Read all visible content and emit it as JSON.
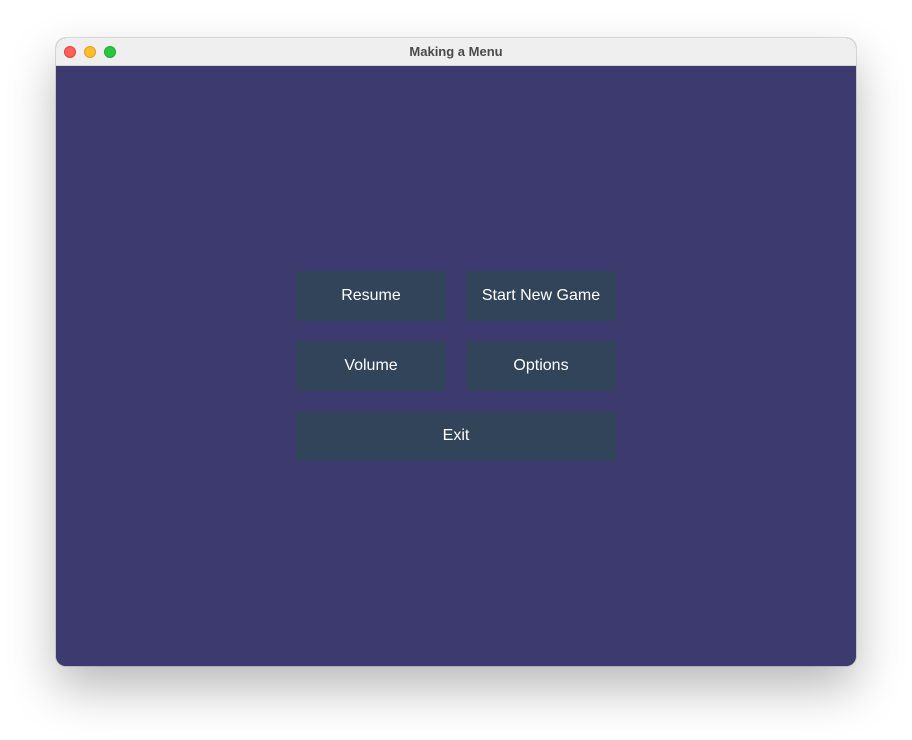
{
  "window": {
    "title": "Making a Menu"
  },
  "colors": {
    "background": "#3c3a6e",
    "button": "#324459",
    "button_text": "#ffffff",
    "titlebar": "#f0efef"
  },
  "menu": {
    "resume_label": "Resume",
    "start_new_game_label": "Start New Game",
    "volume_label": "Volume",
    "options_label": "Options",
    "exit_label": "Exit"
  },
  "traffic_lights": {
    "close_icon": "close-icon",
    "minimize_icon": "minimize-icon",
    "zoom_icon": "zoom-icon"
  }
}
